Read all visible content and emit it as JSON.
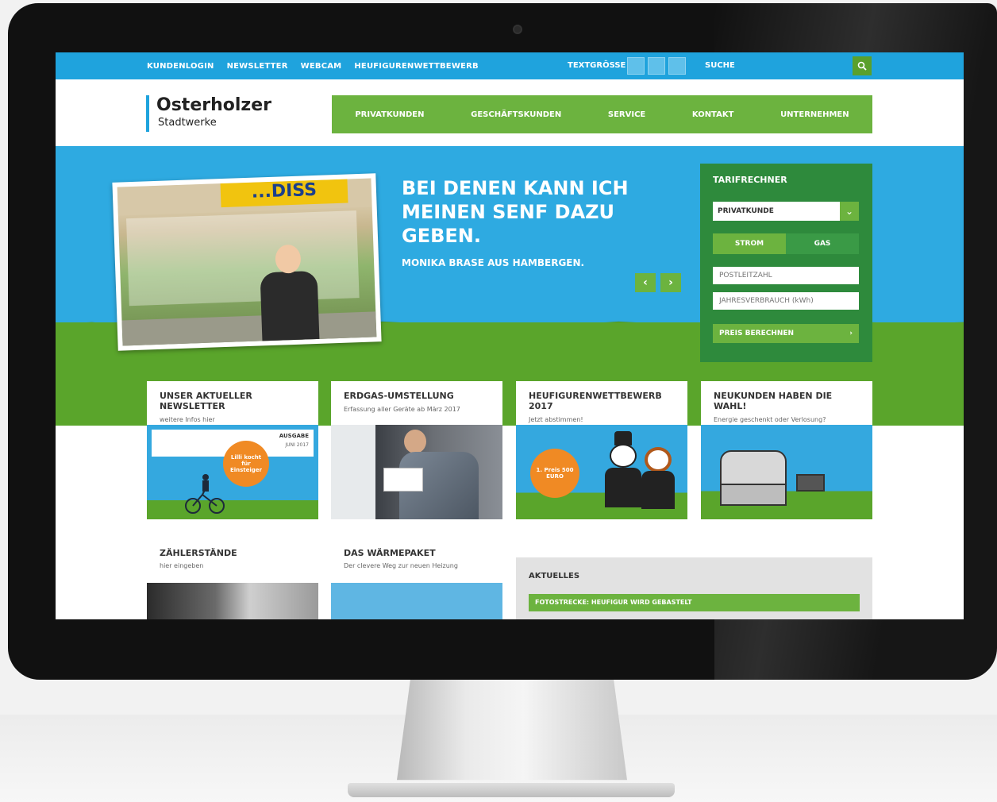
{
  "topbar": {
    "links": [
      "KUNDENLOGIN",
      "NEWSLETTER",
      "WEBCAM",
      "HEUFIGURENWETTBEWERB"
    ],
    "textsize_label": "TEXTGRÖSSE",
    "search_label": "SUCHE"
  },
  "header": {
    "logo_main": "Osterholzer",
    "logo_sub": "Stadtwerke",
    "nav": [
      "PRIVATKUNDEN",
      "GESCHÄFTSKUNDEN",
      "SERVICE",
      "KONTAKT",
      "UNTERNEHMEN"
    ]
  },
  "hero": {
    "headline": "BEI DENEN KANN ICH MEINEN SENF DAZU GEBEN.",
    "sub": "MONIKA BRASE AUS HAMBERGEN.",
    "stall_sign": "...DISS",
    "prev": "‹",
    "next": "›"
  },
  "tarif": {
    "title": "TARIFRECHNER",
    "select_value": "PRIVATKUNDE",
    "tab_strom": "STROM",
    "tab_gas": "GAS",
    "plz_placeholder": "POSTLEITZAHL",
    "verbrauch_placeholder": "JAHRESVERBRAUCH (kWh)",
    "cta": "PREIS BERECHNEN"
  },
  "teasers": [
    {
      "title": "UNSER AKTUELLER NEWSLETTER",
      "sub": "weitere Infos hier",
      "badge": "Lilli kocht für Einsteiger",
      "box_title": "AUSGABE",
      "box_sub": "JUNI 2017"
    },
    {
      "title": "ERDGAS-UMSTELLUNG",
      "sub": "Erfassung aller Geräte ab März 2017"
    },
    {
      "title": "HEUFIGURENWETTBEWERB 2017",
      "sub": "Jetzt abstimmen!",
      "badge": "1. Preis 500 EURO"
    },
    {
      "title": "NEUKUNDEN HABEN DIE WAHL!",
      "sub": "Energie geschenkt oder Verlosung?"
    }
  ],
  "lower": {
    "zaehler_title": "ZÄHLERSTÄNDE",
    "zaehler_sub": "hier eingeben",
    "waerme_title": "DAS WÄRMEPAKET",
    "waerme_sub": "Der clevere Weg zur neuen Heizung",
    "aktuelles_title": "AKTUELLES",
    "aktuelles_item": "FOTOSTRECKE: HEUFIGUR WIRD GEBASTELT"
  },
  "colors": {
    "sky_blue": "#1fa3dd",
    "brand_green": "#6cb33f",
    "dark_green": "#2e8a3c",
    "grass_green": "#5aa52b",
    "badge_orange": "#f08a24"
  }
}
